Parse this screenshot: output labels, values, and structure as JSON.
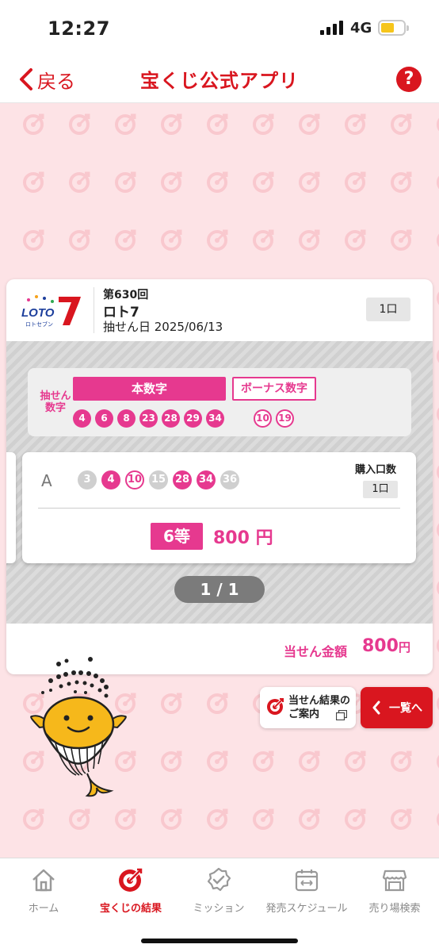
{
  "status": {
    "time": "12:27",
    "network": "4G"
  },
  "nav": {
    "back_label": "戻る",
    "title": "宝くじ公式アプリ",
    "help_label": "?"
  },
  "result": {
    "draw_no": "第630回",
    "game_name": "ロト7",
    "draw_date": "抽せん日 2025/06/13",
    "count_badge": "1口",
    "logo_text": "LOTO7",
    "logo_sub": "ロトセブン",
    "winning_label_line1": "抽せん",
    "winning_label_line2": "数字",
    "main_tab": "本数字",
    "bonus_tab": "ボーナス数字",
    "main_numbers": [
      "4",
      "6",
      "8",
      "23",
      "28",
      "29",
      "34"
    ],
    "bonus_numbers": [
      "10",
      "19"
    ],
    "ticket": {
      "line": "A",
      "numbers": [
        {
          "n": "3",
          "state": "miss"
        },
        {
          "n": "4",
          "state": "hit"
        },
        {
          "n": "10",
          "state": "bonus"
        },
        {
          "n": "15",
          "state": "miss"
        },
        {
          "n": "28",
          "state": "hit"
        },
        {
          "n": "34",
          "state": "hit"
        },
        {
          "n": "36",
          "state": "miss"
        }
      ],
      "purchase_label": "購入口数",
      "purchase_count": "1口",
      "prize_rank": "6等",
      "prize_amount": "800 円"
    },
    "pager": "1 / 1",
    "total_label": "当せん金額",
    "total_value": "800",
    "total_unit": "円"
  },
  "guide": {
    "line1": "当せん結果の",
    "line2": "ご案内"
  },
  "list_button": {
    "label": "一覧へ"
  },
  "tabs": [
    {
      "label": "ホーム",
      "icon": "home-icon",
      "active": false
    },
    {
      "label": "宝くじの結果",
      "icon": "target-icon",
      "active": true
    },
    {
      "label": "ミッション",
      "icon": "badge-check-icon",
      "active": false
    },
    {
      "label": "発売スケジュール",
      "icon": "calendar-icon",
      "active": false
    },
    {
      "label": "売り場検索",
      "icon": "shop-icon",
      "active": false
    }
  ],
  "colors": {
    "brand_red": "#d9161f",
    "pink": "#e6398f",
    "background": "#fde3e6",
    "miss_gray": "#cfcfcf"
  }
}
